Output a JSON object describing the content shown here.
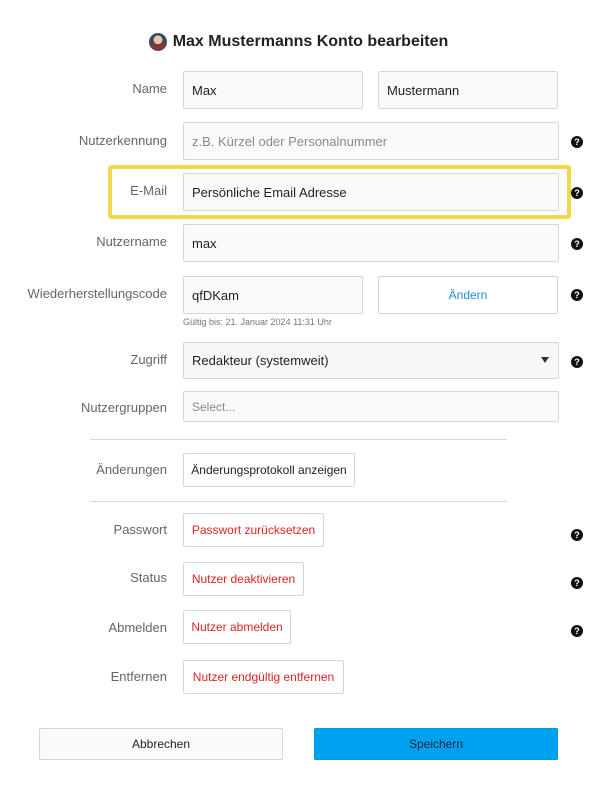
{
  "dialog": {
    "title": "Max Mustermanns Konto bearbeiten"
  },
  "fields": {
    "name": {
      "label": "Name",
      "first_value": "Max",
      "last_value": "Mustermann"
    },
    "nutzerkennung": {
      "label": "Nutzerkennung",
      "placeholder": "z.B. Kürzel oder Personalnummer"
    },
    "email": {
      "label": "E-Mail",
      "value": "Persönliche Email Adresse"
    },
    "nutzername": {
      "label": "Nutzername",
      "value": "max"
    },
    "wiederherstellungscode": {
      "label": "Wiederherstellungscode",
      "value": "qfDKam",
      "change_label": "Ändern",
      "valid_until": "Gültig bis: 21. Januar 2024 11:31 Uhr"
    },
    "zugriff": {
      "label": "Zugriff",
      "selected": "Redakteur (systemweit)"
    },
    "nutzergruppen": {
      "label": "Nutzergruppen",
      "placeholder": "Select..."
    }
  },
  "changes": {
    "label": "Änderungen",
    "button": "Änderungsprotokoll anzeigen"
  },
  "actions": {
    "passwort": {
      "label": "Passwort",
      "button": "Passwort zurücksetzen"
    },
    "status": {
      "label": "Status",
      "button": "Nutzer deaktivieren"
    },
    "abmelden": {
      "label": "Abmelden",
      "button": "Nutzer abmelden"
    },
    "entfernen": {
      "label": "Entfernen",
      "button": "Nutzer endgültig entfernen"
    }
  },
  "footer": {
    "cancel": "Abbrechen",
    "save": "Speichern"
  },
  "help_glyph": "?",
  "colors": {
    "accent": "#00a0f0",
    "danger": "#e02424",
    "highlight": "#f2d84a",
    "link": "#1a8fe0"
  }
}
